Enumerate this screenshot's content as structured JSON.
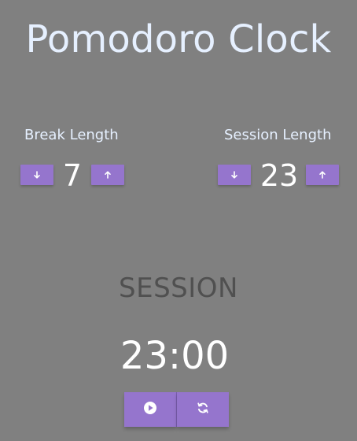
{
  "app": {
    "title": "Pomodoro Clock"
  },
  "break": {
    "label": "Break Length",
    "value": "7",
    "decrement_icon": "arrow-down-icon",
    "increment_icon": "arrow-up-icon"
  },
  "session": {
    "label": "Session Length",
    "value": "23",
    "decrement_icon": "arrow-down-icon",
    "increment_icon": "arrow-up-icon"
  },
  "timer": {
    "mode": "SESSION",
    "time": "23:00",
    "play_icon": "play-icon",
    "reset_icon": "refresh-icon"
  },
  "colors": {
    "background": "#808080",
    "accent": "#9575cd",
    "title_text": "#e6f0ff",
    "mode_text": "#505050"
  }
}
